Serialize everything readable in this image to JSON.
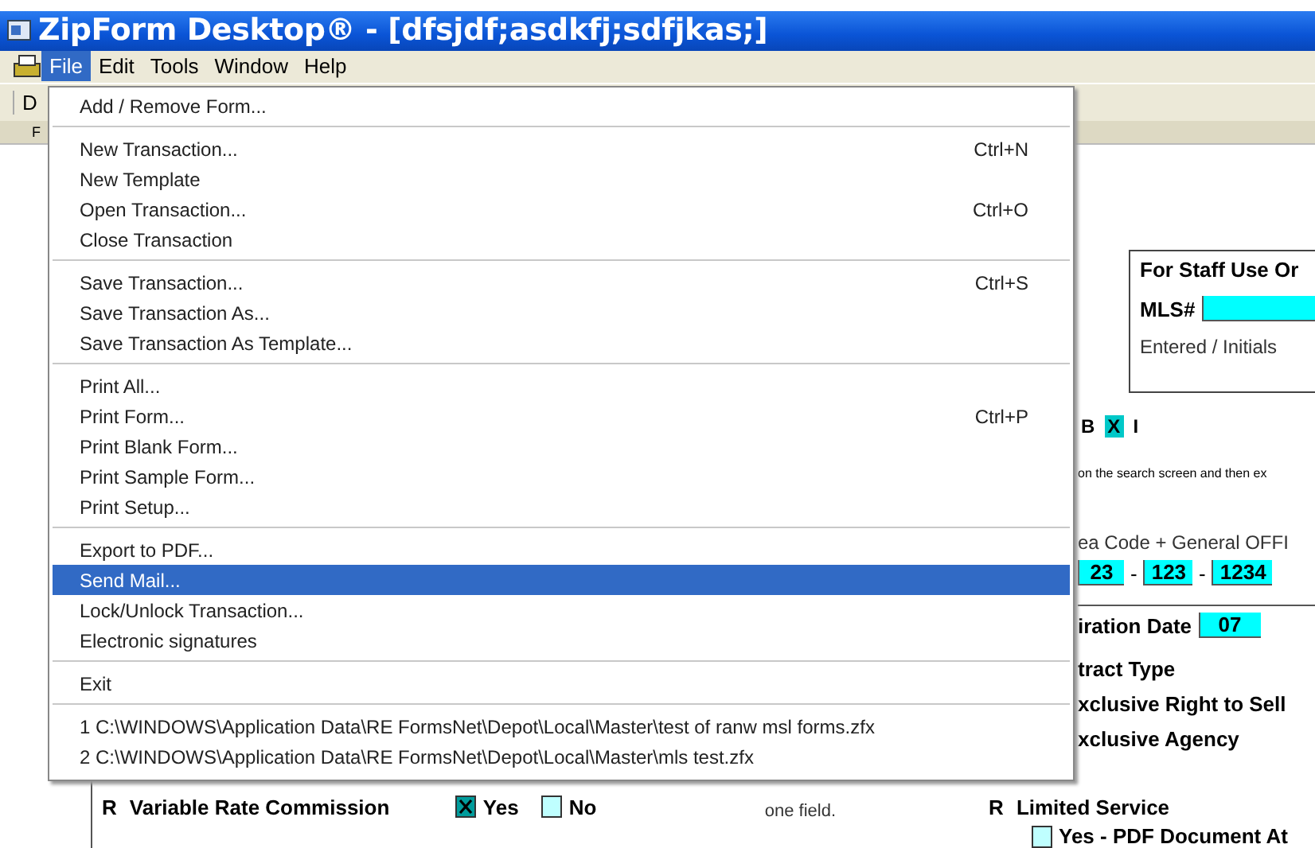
{
  "window": {
    "title": "ZipForm Desktop® - [dfsjdf;asdkfj;sdfjkas;]"
  },
  "menu_bar": [
    {
      "label": "File",
      "selected": true
    },
    {
      "label": "Edit",
      "selected": false
    },
    {
      "label": "Tools",
      "selected": false
    },
    {
      "label": "Window",
      "selected": false
    },
    {
      "label": "Help",
      "selected": false
    }
  ],
  "toolbar": {
    "button": "D",
    "tab": "F"
  },
  "file_menu": {
    "groups": [
      [
        {
          "label": "Add / Remove Form...",
          "selected": false
        }
      ],
      [
        {
          "label": "New Transaction...",
          "shortcut": "Ctrl+N",
          "selected": false
        },
        {
          "label": "New Template",
          "selected": false
        },
        {
          "label": "Open Transaction...",
          "shortcut": "Ctrl+O",
          "selected": false
        },
        {
          "label": "Close Transaction",
          "selected": false
        }
      ],
      [
        {
          "label": "Save Transaction...",
          "shortcut": "Ctrl+S",
          "selected": false
        },
        {
          "label": "Save Transaction As...",
          "selected": false
        },
        {
          "label": "Save Transaction As Template...",
          "selected": false
        }
      ],
      [
        {
          "label": "Print All...",
          "selected": false
        },
        {
          "label": "Print Form...",
          "shortcut": "Ctrl+P",
          "selected": false
        },
        {
          "label": "Print Blank Form...",
          "selected": false
        },
        {
          "label": "Print Sample Form...",
          "selected": false
        },
        {
          "label": "Print Setup...",
          "selected": false
        }
      ],
      [
        {
          "label": "Export to PDF...",
          "selected": false
        },
        {
          "label": "Send Mail...",
          "selected": true
        },
        {
          "label": "Lock/Unlock Transaction...",
          "selected": false
        },
        {
          "label": "Electronic signatures",
          "selected": false
        }
      ],
      [
        {
          "label": "Exit",
          "selected": false
        }
      ],
      [
        {
          "label": "1 C:\\WINDOWS\\Application Data\\RE FormsNet\\Depot\\Local\\Master\\test of ranw msl forms.zfx",
          "selected": false
        },
        {
          "label": "2 C:\\WINDOWS\\Application Data\\RE FormsNet\\Depot\\Local\\Master\\mls test.zfx",
          "selected": false
        }
      ]
    ]
  },
  "form": {
    "staff_box": {
      "title": "For Staff Use Or",
      "mls_label": "MLS#",
      "entered_label": "Entered / Initials"
    },
    "format_buttons": [
      {
        "label": "B",
        "selected": false
      },
      {
        "label": "X",
        "selected": true
      },
      {
        "label": "I",
        "selected": false
      }
    ],
    "hint": "on the search screen and then ex",
    "phone_label": "ea Code + General OFFI",
    "phone_fields": [
      "23",
      "123",
      "1234"
    ],
    "phone_separator": "-",
    "expiration": {
      "label": "iration Date",
      "value": "07"
    },
    "contract_type": {
      "label": "tract Type",
      "options": [
        "xclusive Right to Sell",
        "xclusive Agency"
      ]
    },
    "variable_rate": {
      "marker": "R",
      "label": "Variable Rate Commission",
      "options": [
        {
          "label": "Yes",
          "checked": true
        },
        {
          "label": "No",
          "checked": false
        }
      ]
    },
    "note": "one field.",
    "limited_service": {
      "marker": "R",
      "label": "Limited Service",
      "option": {
        "label": "Yes - PDF Document At",
        "checked": false
      }
    }
  }
}
